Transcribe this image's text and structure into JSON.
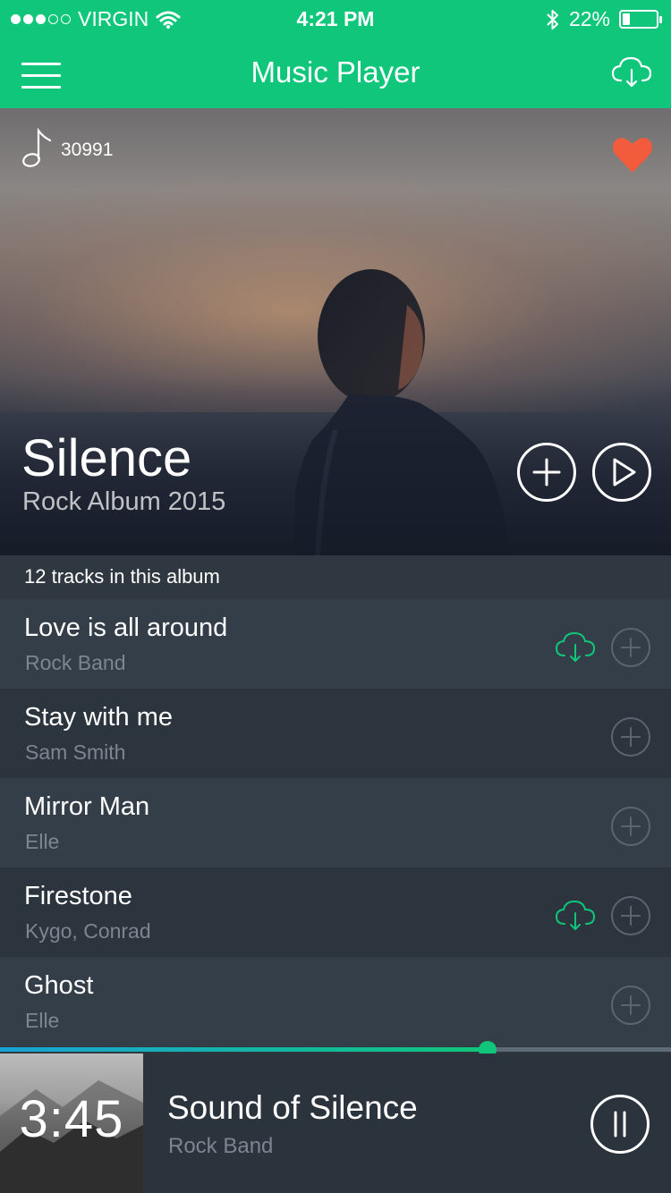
{
  "status_bar": {
    "carrier": "VIRGIN",
    "time": "4:21 PM",
    "battery": "22%",
    "battery_level": 0.22,
    "signal_bars_filled": 3,
    "signal_bars_total": 5
  },
  "nav": {
    "title": "Music Player",
    "menu_icon": "hamburger-menu-icon",
    "download_icon": "cloud-download-icon"
  },
  "hero": {
    "play_count": "30991",
    "album_title": "Silence",
    "album_subtitle": "Rock Album 2015",
    "favorite_color": "#f25c3c"
  },
  "list": {
    "header": "12 tracks in this album",
    "tracks": [
      {
        "title": "Love is all around",
        "artist": "Rock Band",
        "downloadable": true
      },
      {
        "title": "Stay with me",
        "artist": "Sam Smith",
        "downloadable": false
      },
      {
        "title": "Mirror Man",
        "artist": "Elle",
        "downloadable": false
      },
      {
        "title": "Firestone",
        "artist": "Kygo, Conrad",
        "downloadable": true
      },
      {
        "title": "Ghost",
        "artist": "Elle",
        "downloadable": false
      }
    ]
  },
  "player": {
    "elapsed": "3:45",
    "title": "Sound of Silence",
    "artist": "Rock Band",
    "progress": 0.727
  },
  "colors": {
    "accent": "#0fc67a",
    "progress_start": "#1aa3d6",
    "list_bg": "#2f3841"
  }
}
